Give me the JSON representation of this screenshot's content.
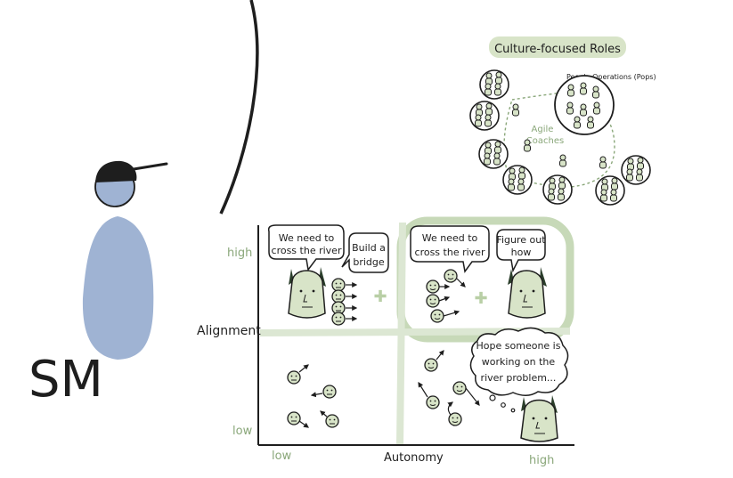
{
  "sm_figure": {
    "initials": "SM"
  },
  "culture_panel": {
    "title": "Culture-focused Roles",
    "pops_label": "People Operations (Pops)",
    "agile_label_line1": "Agile",
    "agile_label_line2": "Coaches"
  },
  "matrix": {
    "y_axis_label": "Alignment",
    "x_axis_label": "Autonomy",
    "y_high": "high",
    "y_low": "low",
    "x_low": "low",
    "x_high": "high",
    "q1_bubble_line1": "We need to",
    "q1_bubble_line2": "cross the river",
    "q1_reply_line1": "Build a",
    "q1_reply_line2": "bridge",
    "q2_bubble_line1": "We need to",
    "q2_bubble_line2": "cross the river",
    "q2_reply_line1": "Figure out",
    "q2_reply_line2": "how",
    "q4_thought_line1": "Hope someone is",
    "q4_thought_line2": "working on the",
    "q4_thought_line3": "river problem..."
  },
  "colors": {
    "ink": "#1e1e1e",
    "person_blue": "#9fb3d3",
    "accent_green": "#b9cfa6",
    "leader_green": "#d8e4c8",
    "dark_tree": "#2b3f2b"
  }
}
